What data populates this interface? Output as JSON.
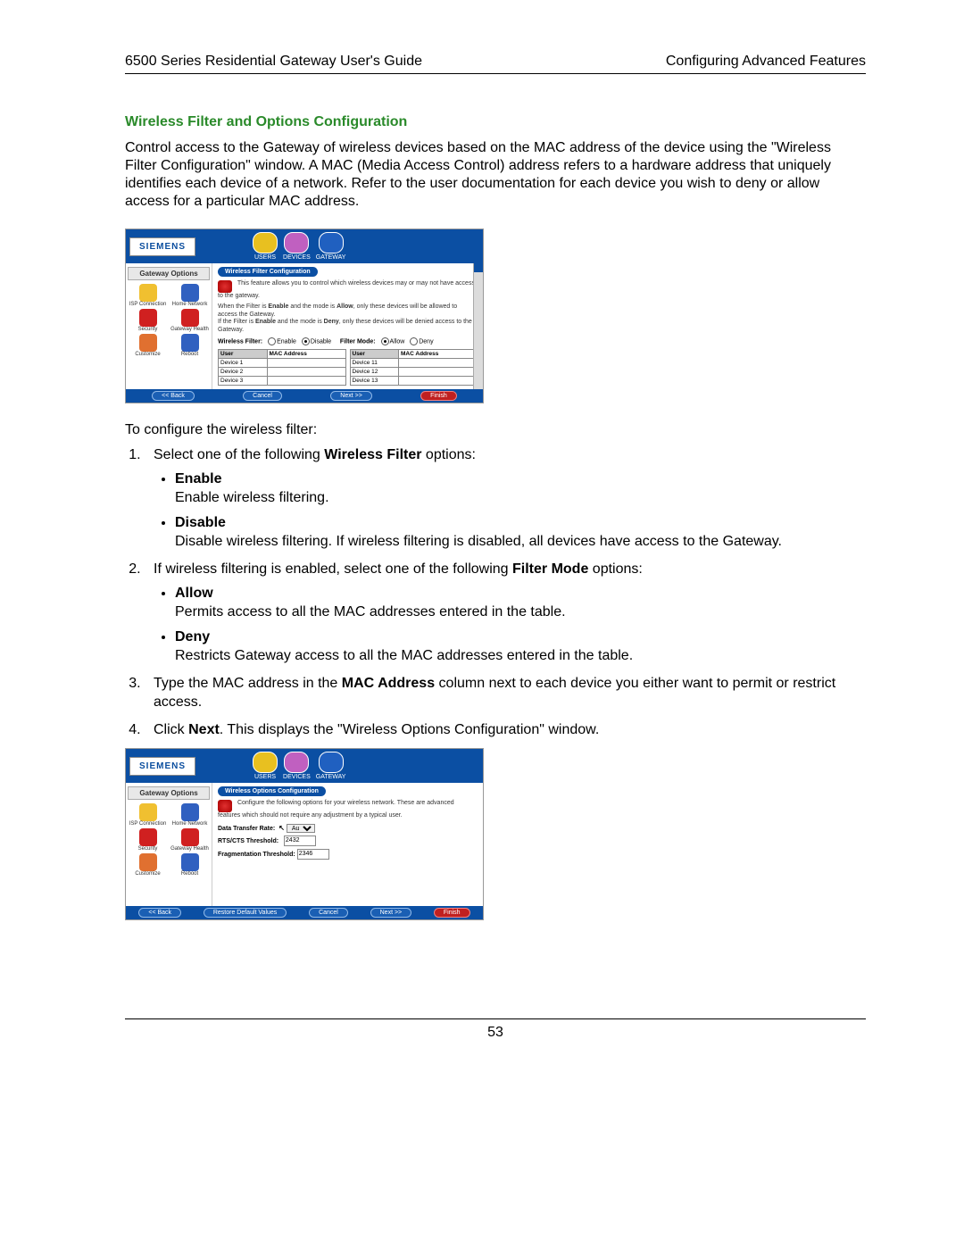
{
  "header": {
    "left": "6500 Series Residential Gateway User's Guide",
    "right": "Configuring Advanced Features"
  },
  "section_title": "Wireless Filter and Options Configuration",
  "intro": "Control access to the Gateway of wireless devices based on the MAC address of the device using the \"Wireless Filter Configuration\" window. A MAC (Media Access Control) address refers to a hardware address that uniquely identifies each device of a network. Refer to the user documentation for each device you wish to deny or allow access for a particular MAC address.",
  "screenshot1": {
    "brand": "SIEMENS",
    "nav": [
      "USERS",
      "DEVICES",
      "GATEWAY"
    ],
    "nav_colors": [
      "#e8c020",
      "#c060c0",
      "#2060c0"
    ],
    "sidebar_title": "Gateway Options",
    "sidebar_items": [
      "ISP Connection",
      "Home Network",
      "Security",
      "Gateway Health",
      "Customize",
      "Reboot"
    ],
    "sidebar_colors": [
      "#f0c030",
      "#3060c0",
      "#d02020",
      "#d02020",
      "#e07030",
      "#3060c0"
    ],
    "pill": "Wireless Filter Configuration",
    "desc1": "This feature allows you to control which wireless devices may or may not have access to the gateway.",
    "desc2_a": "When the Filter is ",
    "desc2_b": " and the mode is ",
    "desc2_c": ", only these devices will be allowed to access the Gateway.",
    "desc3_a": "If the Filter is ",
    "desc3_b": " and the mode is ",
    "desc3_c": ", only these devices will be denied access to the Gateway.",
    "enable_word": "Enable",
    "allow_word": "Allow",
    "deny_word": "Deny",
    "wf_label": "Wireless Filter:",
    "wf_opts": [
      "Enable",
      "Disable"
    ],
    "fm_label": "Filter Mode:",
    "fm_opts": [
      "Allow",
      "Deny"
    ],
    "col_heads": [
      "User",
      "MAC Address"
    ],
    "left_rows": [
      "Device 1",
      "Device 2",
      "Device 3"
    ],
    "right_rows": [
      "Device 11",
      "Device 12",
      "Device 13"
    ],
    "buttons": [
      "<< Back",
      "Cancel",
      "Next >>",
      "Finish"
    ]
  },
  "configure_intro": "To configure the wireless filter:",
  "step1": {
    "text_a": "Select one of the following ",
    "bold": "Wireless Filter",
    "text_b": " options:",
    "bullets": [
      {
        "head": "Enable",
        "body": "Enable wireless filtering."
      },
      {
        "head": "Disable",
        "body": "Disable wireless filtering. If wireless filtering is disabled, all devices have access to the Gateway."
      }
    ]
  },
  "step2": {
    "text_a": "If wireless filtering is enabled, select one of the following ",
    "bold": "Filter Mode",
    "text_b": " options:",
    "bullets": [
      {
        "head": "Allow",
        "body": "Permits access to all the MAC addresses entered in the table."
      },
      {
        "head": "Deny",
        "body": "Restricts Gateway access to all the MAC addresses entered in the table."
      }
    ]
  },
  "step3": {
    "text_a": "Type the MAC address in the ",
    "bold": "MAC Address",
    "text_b": " column next to each device you either want to permit or restrict access."
  },
  "step4": {
    "text_a": "Click ",
    "bold": "Next",
    "text_b": ". This displays the \"Wireless Options Configuration\" window."
  },
  "screenshot2": {
    "pill": "Wireless Options Configuration",
    "desc": "Configure the following options for your wireless network. These are advanced features which should not require any adjustment by a typical user.",
    "fields": [
      {
        "label": "Data Transfer Rate:",
        "value": "Auto",
        "type": "select"
      },
      {
        "label": "RTS/CTS Threshold:",
        "value": "2432",
        "type": "input"
      },
      {
        "label": "Fragmentation Threshold:",
        "value": "2346",
        "type": "input"
      }
    ],
    "buttons": [
      "<< Back",
      "Restore Default Values",
      "Cancel",
      "Next >>",
      "Finish"
    ]
  },
  "page_number": "53"
}
